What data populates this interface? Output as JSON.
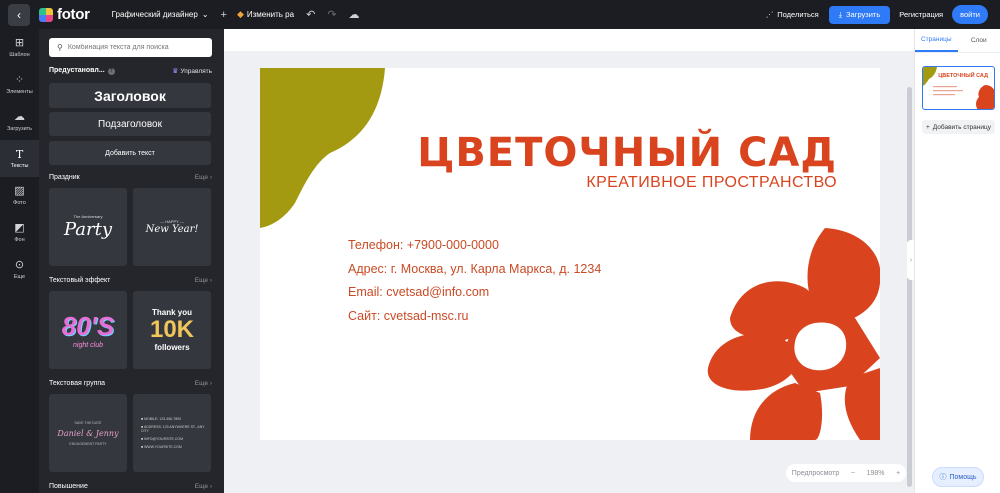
{
  "topbar": {
    "logo_text": "fotor",
    "mode": "Графический дизайнер",
    "resize_label": "Изменить ра",
    "share_label": "Поделиться",
    "upload_label": "Загрузить",
    "register_label": "Регистрация",
    "login_label": "войти"
  },
  "rail": [
    {
      "icon": "template-icon",
      "label": "Шаблон"
    },
    {
      "icon": "elements-icon",
      "label": "Элементы"
    },
    {
      "icon": "upload-cloud-icon",
      "label": "Загрузить"
    },
    {
      "icon": "text-icon",
      "label": "Тексты"
    },
    {
      "icon": "photo-icon",
      "label": "Фото"
    },
    {
      "icon": "background-icon",
      "label": "Фон"
    },
    {
      "icon": "more-icon",
      "label": "Еще"
    }
  ],
  "panel": {
    "search_placeholder": "Комбинация текста для поиска",
    "presets_title": "Предустановл...",
    "manage_label": "Управлять",
    "heading_btn": "Заголовок",
    "subheading_btn": "Подзаголовок",
    "add_text_btn": "Добавить текст",
    "more_label": "Еще",
    "sections": {
      "holiday": "Праздник",
      "effect": "Текстовый эффект",
      "group": "Текстовая группа",
      "promo": "Повышение"
    },
    "tiles": {
      "party_small": "The Anniversary",
      "party_big": "Party",
      "ny_small": "— HAPPY —",
      "ny_big": "New Year!",
      "eighties_big": "80'S",
      "eighties_small": "night club",
      "tenk_top": "Thank you",
      "tenk_big": "10K",
      "tenk_bottom": "followers",
      "wedding_top": "SAVE THE DATE",
      "wedding_names": "Daniel & Jenny",
      "wedding_bottom": "ENGAGEMENT PARTY",
      "contact_l1": "■ MOBILE: 123-456-7890",
      "contact_l2": "■ ADDRESS: 123 ANYWHERE ST., ANY CITY",
      "contact_l3": "■ INFO@YOURSITE.COM",
      "contact_l4": "■ WWW.YOURSITE.COM"
    }
  },
  "card": {
    "title": "ЦВЕТОЧНЫЙ САД",
    "subtitle": "КРЕАТИВНОЕ ПРОСТРАНСТВО",
    "phone": "Телефон: +7900-000-0000",
    "address": "Адрес: г. Москва, ул. Карла Маркса, д. 1234",
    "email": "Email: cvetsad@info.com",
    "site": "Сайт: cvetsad-msc.ru",
    "colors": {
      "orange": "#d9441f",
      "olive": "#a39a12"
    }
  },
  "zoom": {
    "preview_label": "Предпросмотр",
    "minus": "−",
    "value": "198%",
    "plus": "+"
  },
  "rpanel": {
    "tab_pages": "Страницы",
    "tab_layers": "Слои",
    "add_page": "Добавить страницу",
    "thumb_title": "ЦВЕТОЧНЫЙ САД"
  },
  "help_label": "Помощь"
}
